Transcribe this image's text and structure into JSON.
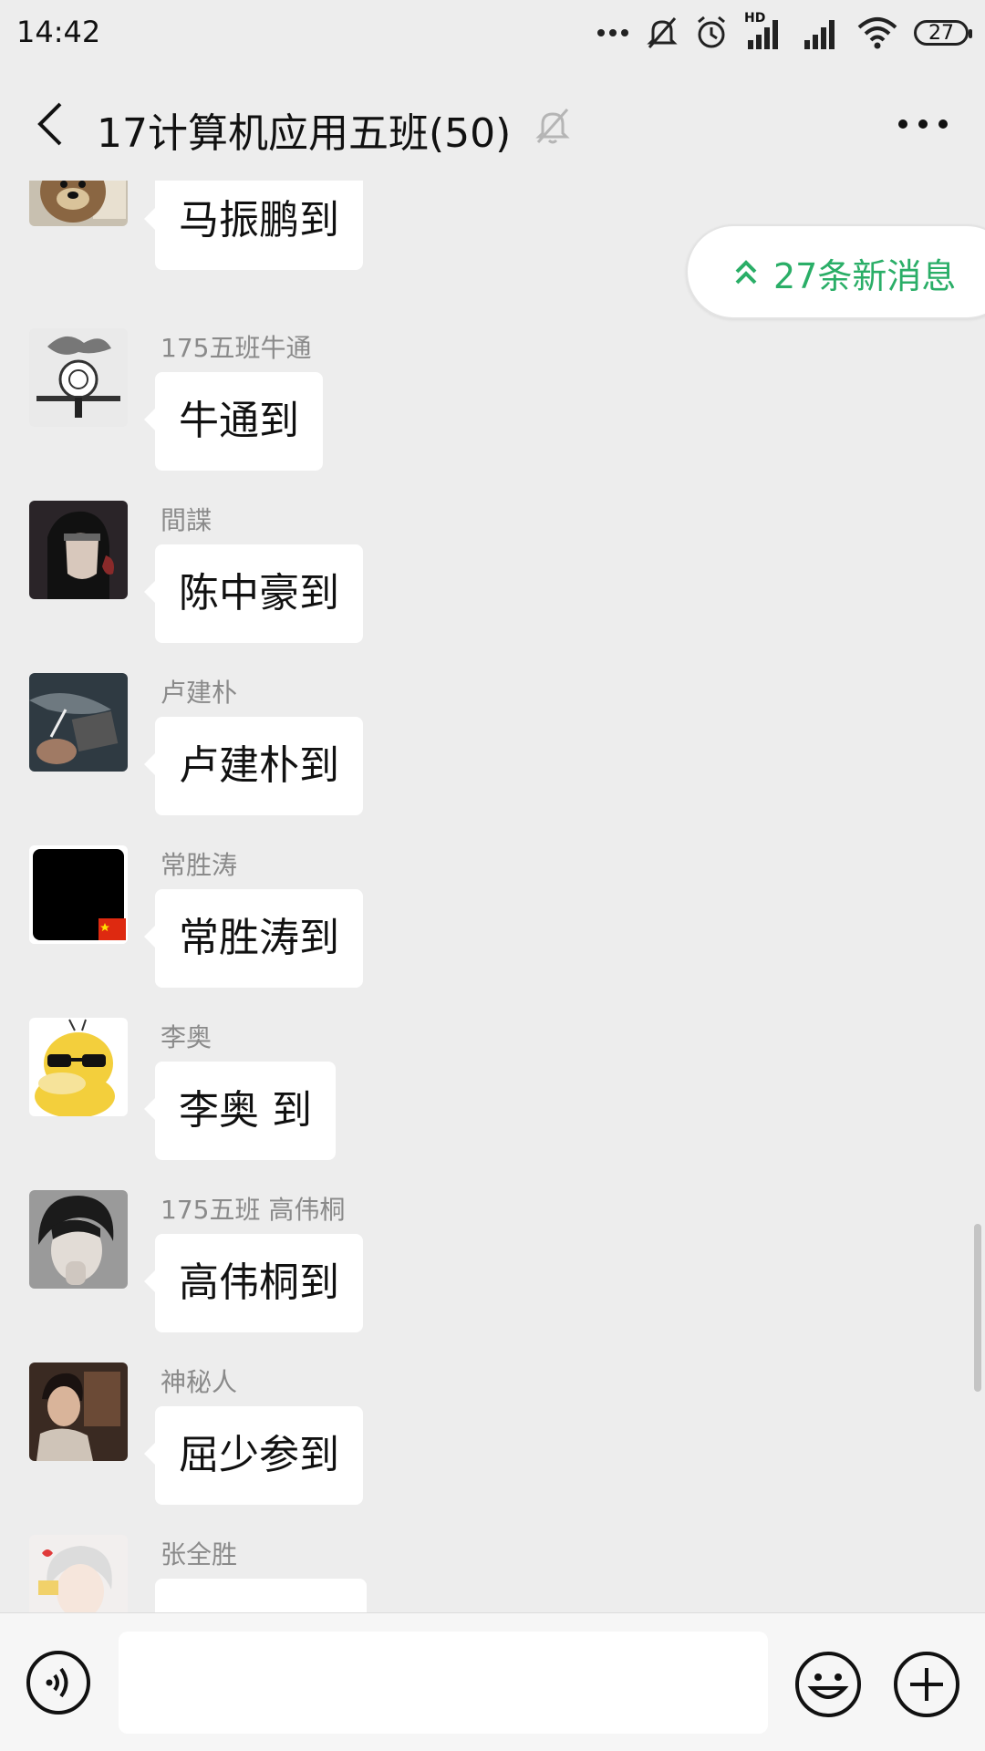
{
  "status_bar": {
    "time": "14:42",
    "battery": "27",
    "network_badge": "HD"
  },
  "header": {
    "title": "17计算机应用五班(50)",
    "back_icon": "back-arrow-icon",
    "mute_icon": "bell-off-icon",
    "more_icon": "more-dots-icon"
  },
  "new_messages": {
    "label": "27条新消息"
  },
  "messages": [
    {
      "sender": "",
      "text": "马振鹏到",
      "avatar_color": "#9a7b55"
    },
    {
      "sender": "175五班牛通",
      "text": "牛通到",
      "avatar_color": "#cfcfcf"
    },
    {
      "sender": "間諜",
      "text": "陈中豪到",
      "avatar_color": "#2a2428"
    },
    {
      "sender": "卢建朴",
      "text": "卢建朴到",
      "avatar_color": "#3a4650"
    },
    {
      "sender": "常胜涛",
      "text": "常胜涛到",
      "avatar_color": "#000000"
    },
    {
      "sender": "李奥",
      "text": "李奥 到",
      "avatar_color": "#f0c93a"
    },
    {
      "sender": "175五班 高伟桐",
      "text": "高伟桐到",
      "avatar_color": "#6d6d6d"
    },
    {
      "sender": "神秘人",
      "text": "屈少参到",
      "avatar_color": "#5a3a2a"
    },
    {
      "sender": "张全胜",
      "text": "",
      "avatar_color": "#e6e2e0"
    }
  ],
  "input": {
    "placeholder": "",
    "value": ""
  },
  "colors": {
    "accent_green": "#2aae67",
    "background": "#ededed",
    "bubble": "#ffffff"
  }
}
